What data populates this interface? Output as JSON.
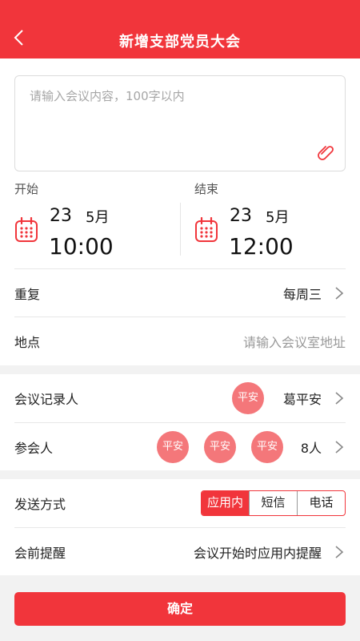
{
  "header": {
    "title": "新增支部党员大会"
  },
  "content": {
    "placeholder": "请输入会议内容，100字以内"
  },
  "start": {
    "label": "开始",
    "day": "23",
    "month": "5月",
    "time": "10:00"
  },
  "end": {
    "label": "结束",
    "day": "23",
    "month": "5月",
    "time": "12:00"
  },
  "repeat": {
    "label": "重复",
    "value": "每周三"
  },
  "location": {
    "label": "地点",
    "placeholder": "请输入会议室地址"
  },
  "recorder": {
    "label": "会议记录人",
    "avatar": "平安",
    "name": "葛平安"
  },
  "attendees": {
    "label": "参会人",
    "avatars": [
      "平安",
      "平安",
      "平安"
    ],
    "count": "8人"
  },
  "send": {
    "label": "发送方式",
    "options": [
      "应用内",
      "短信",
      "电话"
    ],
    "selected": "应用内"
  },
  "reminder": {
    "label": "会前提醒",
    "value": "会议开始时应用内提醒"
  },
  "confirm": {
    "label": "确定"
  },
  "colors": {
    "accent": "#f1353b",
    "avatar": "#f4777a"
  }
}
